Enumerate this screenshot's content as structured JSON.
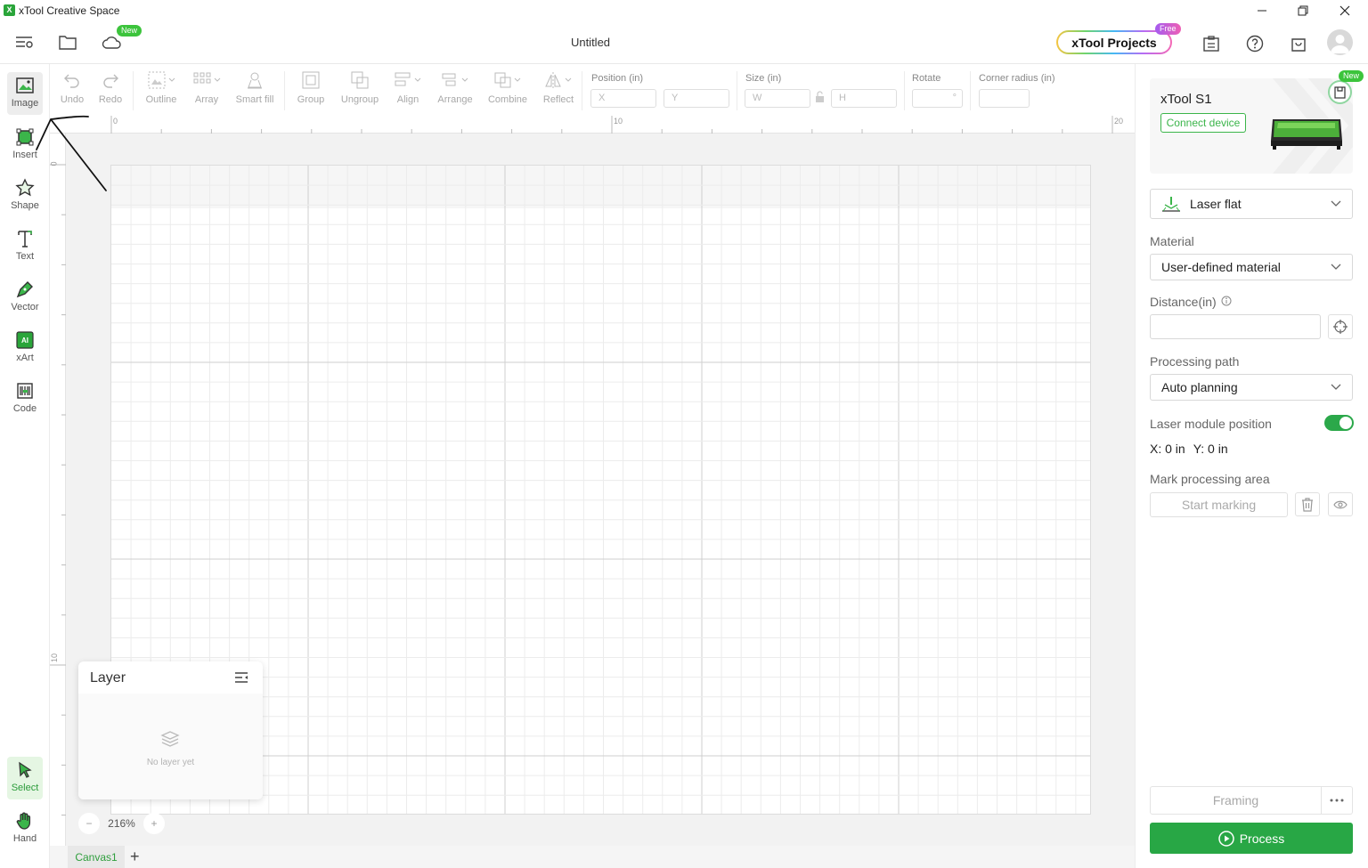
{
  "window": {
    "title": "xTool Creative Space"
  },
  "header": {
    "document_title": "Untitled",
    "cloud_badge": "New",
    "projects_button": "xTool Projects",
    "projects_badge": "Free"
  },
  "left_tools": [
    {
      "label": "Image",
      "icon": "image-icon"
    },
    {
      "label": "Insert",
      "icon": "insert-icon"
    },
    {
      "label": "Shape",
      "icon": "star-icon"
    },
    {
      "label": "Text",
      "icon": "text-icon"
    },
    {
      "label": "Vector",
      "icon": "pen-icon"
    },
    {
      "label": "xArt",
      "icon": "ai-icon"
    },
    {
      "label": "Code",
      "icon": "barcode-icon"
    }
  ],
  "bottom_tools": [
    {
      "label": "Select",
      "icon": "cursor-icon"
    },
    {
      "label": "Hand",
      "icon": "hand-icon"
    }
  ],
  "toolbar": {
    "undo": "Undo",
    "redo": "Redo",
    "outline": "Outline",
    "array": "Array",
    "smart_fill": "Smart fill",
    "group": "Group",
    "ungroup": "Ungroup",
    "align": "Align",
    "arrange": "Arrange",
    "combine": "Combine",
    "reflect": "Reflect",
    "position_label": "Position (in)",
    "x_placeholder": "X",
    "y_placeholder": "Y",
    "size_label": "Size (in)",
    "w_placeholder": "W",
    "h_placeholder": "H",
    "rotate_label": "Rotate",
    "rotate_unit": "°",
    "corner_label": "Corner radius (in)"
  },
  "rulers": {
    "h_ticks": [
      "0",
      "10",
      "20"
    ],
    "v_ticks": [
      "0",
      "10"
    ]
  },
  "layer_panel": {
    "title": "Layer",
    "empty_text": "No layer yet"
  },
  "zoom": {
    "minus": "−",
    "value": "216%",
    "plus": "+"
  },
  "tabs": {
    "canvas": "Canvas1",
    "add": "+"
  },
  "right_panel": {
    "device_badge": "New",
    "device_name": "xTool S1",
    "connect_button": "Connect device",
    "mode": "Laser flat",
    "material_label": "Material",
    "material_value": "User-defined material",
    "distance_label": "Distance(in)",
    "processing_path_label": "Processing path",
    "processing_path_value": "Auto planning",
    "laser_module_label": "Laser module position",
    "laser_module_enabled": true,
    "x_readout": "X: 0 in",
    "y_readout": "Y: 0 in",
    "mark_area_label": "Mark processing area",
    "start_marking": "Start marking",
    "framing": "Framing",
    "process": "Process"
  },
  "colors": {
    "accent": "#28a745",
    "accent_text": "#2e9e3c"
  }
}
